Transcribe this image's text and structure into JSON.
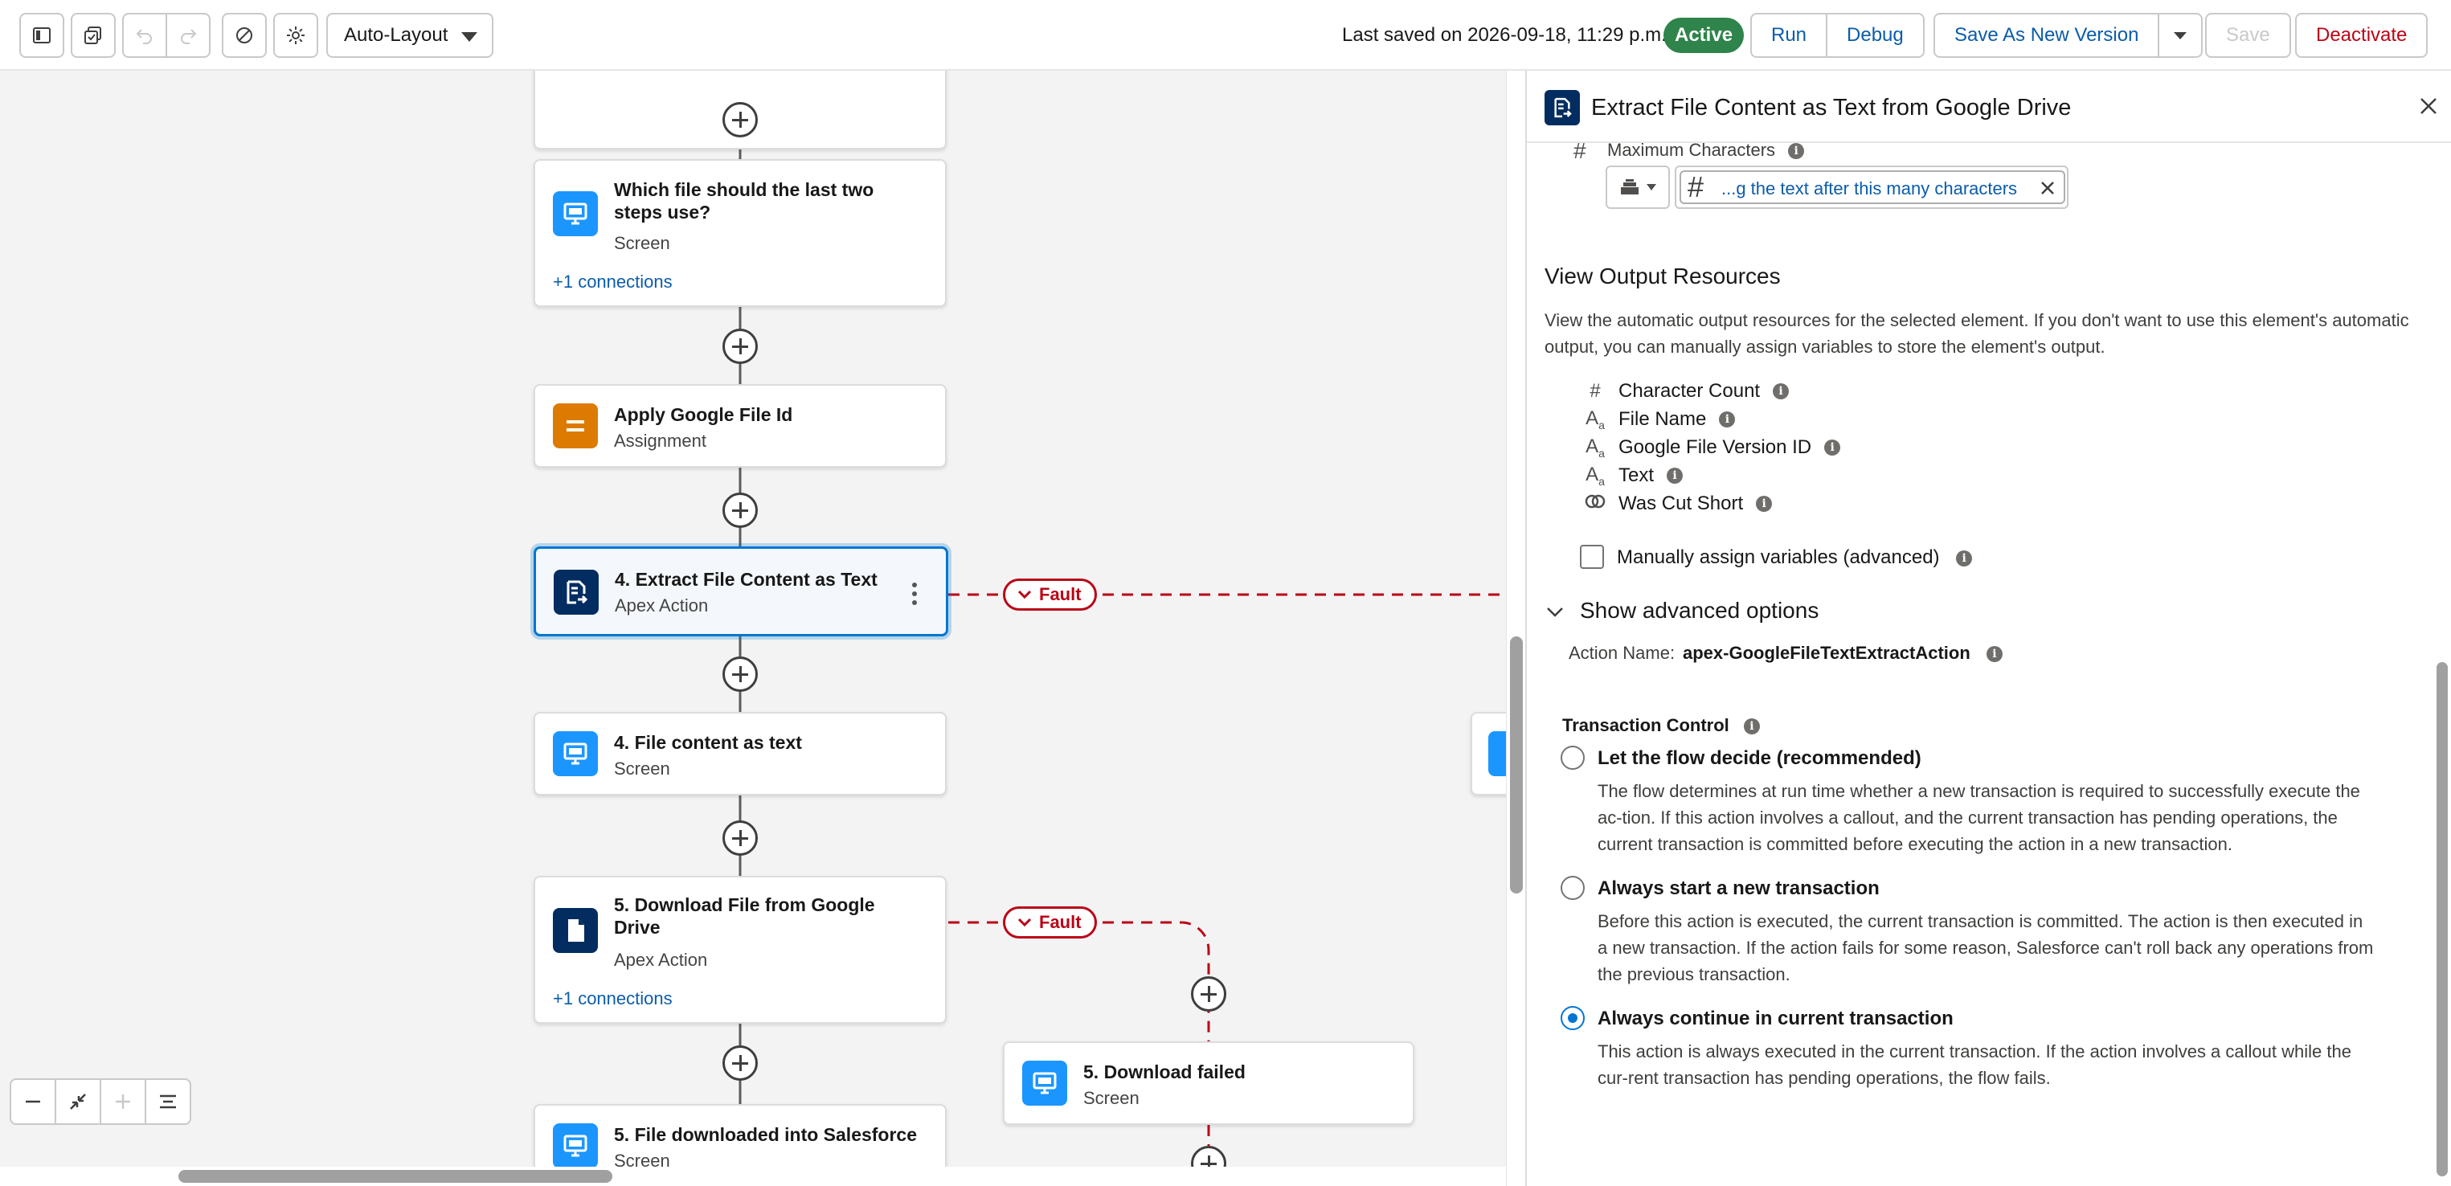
{
  "toolbar": {
    "layout_mode": "Auto-Layout",
    "last_saved": "Last saved on 2026-09-18, 11:29 p.m.",
    "status_badge": "Active",
    "run_label": "Run",
    "debug_label": "Debug",
    "save_as_new_version_label": "Save As New Version",
    "save_label": "Save",
    "deactivate_label": "Deactivate",
    "icons": [
      "toggle-sidebar-icon",
      "flow-versions-icon",
      "undo-icon",
      "redo-icon",
      "errors-icon",
      "settings-icon"
    ]
  },
  "canvas": {
    "nodes": [
      {
        "title": "Which file should the last two steps use?",
        "type": "Screen",
        "link": "+1 connections"
      },
      {
        "title": "Apply Google File Id",
        "type": "Assignment"
      },
      {
        "title": "4. Extract File Content as Text",
        "type": "Apex Action",
        "selected": true
      },
      {
        "title": "4. File content as text",
        "type": "Screen"
      },
      {
        "title": "5. Download File from Google Drive",
        "type": "Apex Action",
        "link": "+1 connections"
      },
      {
        "title": "5. File downloaded into Salesforce",
        "type": "Screen"
      },
      {
        "title": "5. Download failed",
        "type": "Screen"
      }
    ],
    "fault_label": "Fault",
    "colors": {
      "screen": "#1b96ff",
      "assignment": "#dd7a01",
      "apex": "#032d60",
      "fault": "#ba0517",
      "selected": "#0176d3"
    }
  },
  "panel": {
    "title": "Extract File Content as Text from Google Drive",
    "max_chars_label": "Maximum Characters",
    "max_chars_value": "...g the text after this many characters",
    "view_output_heading": "View Output Resources",
    "view_output_desc": "View the automatic output resources for the selected element. If you don't want to use this element's automatic output, you can manually assign variables to store the element's output.",
    "resources": [
      {
        "icon": "number-icon",
        "label": "Character Count"
      },
      {
        "icon": "text-icon",
        "label": "File Name"
      },
      {
        "icon": "text-icon",
        "label": "Google File Version ID"
      },
      {
        "icon": "text-icon",
        "label": "Text"
      },
      {
        "icon": "boolean-icon",
        "label": "Was Cut Short"
      }
    ],
    "manual_assign_label": "Manually assign variables (advanced)",
    "advanced_label": "Show advanced options",
    "action_name_label": "Action Name:",
    "action_name_value": "apex-GoogleFileTextExtractAction",
    "transaction_control_label": "Transaction Control",
    "options": [
      {
        "label": "Let the flow decide (recommended)",
        "desc": "The flow determines at run time whether a new transaction is required to successfully execute the ac-tion. If this action involves a callout, and the current transaction has pending operations, the current transaction is committed before executing the action in a new transaction.",
        "selected": false
      },
      {
        "label": "Always start a new transaction",
        "desc": "Before this action is executed, the current transaction is committed. The action is then executed in a new transaction. If the action fails for some reason, Salesforce can't roll back any operations from the previous transaction.",
        "selected": false
      },
      {
        "label": "Always continue in current transaction",
        "desc": "This action is always executed in the current transaction. If the action involves a callout while the cur-rent transaction has pending operations, the flow fails.",
        "selected": true
      }
    ]
  }
}
